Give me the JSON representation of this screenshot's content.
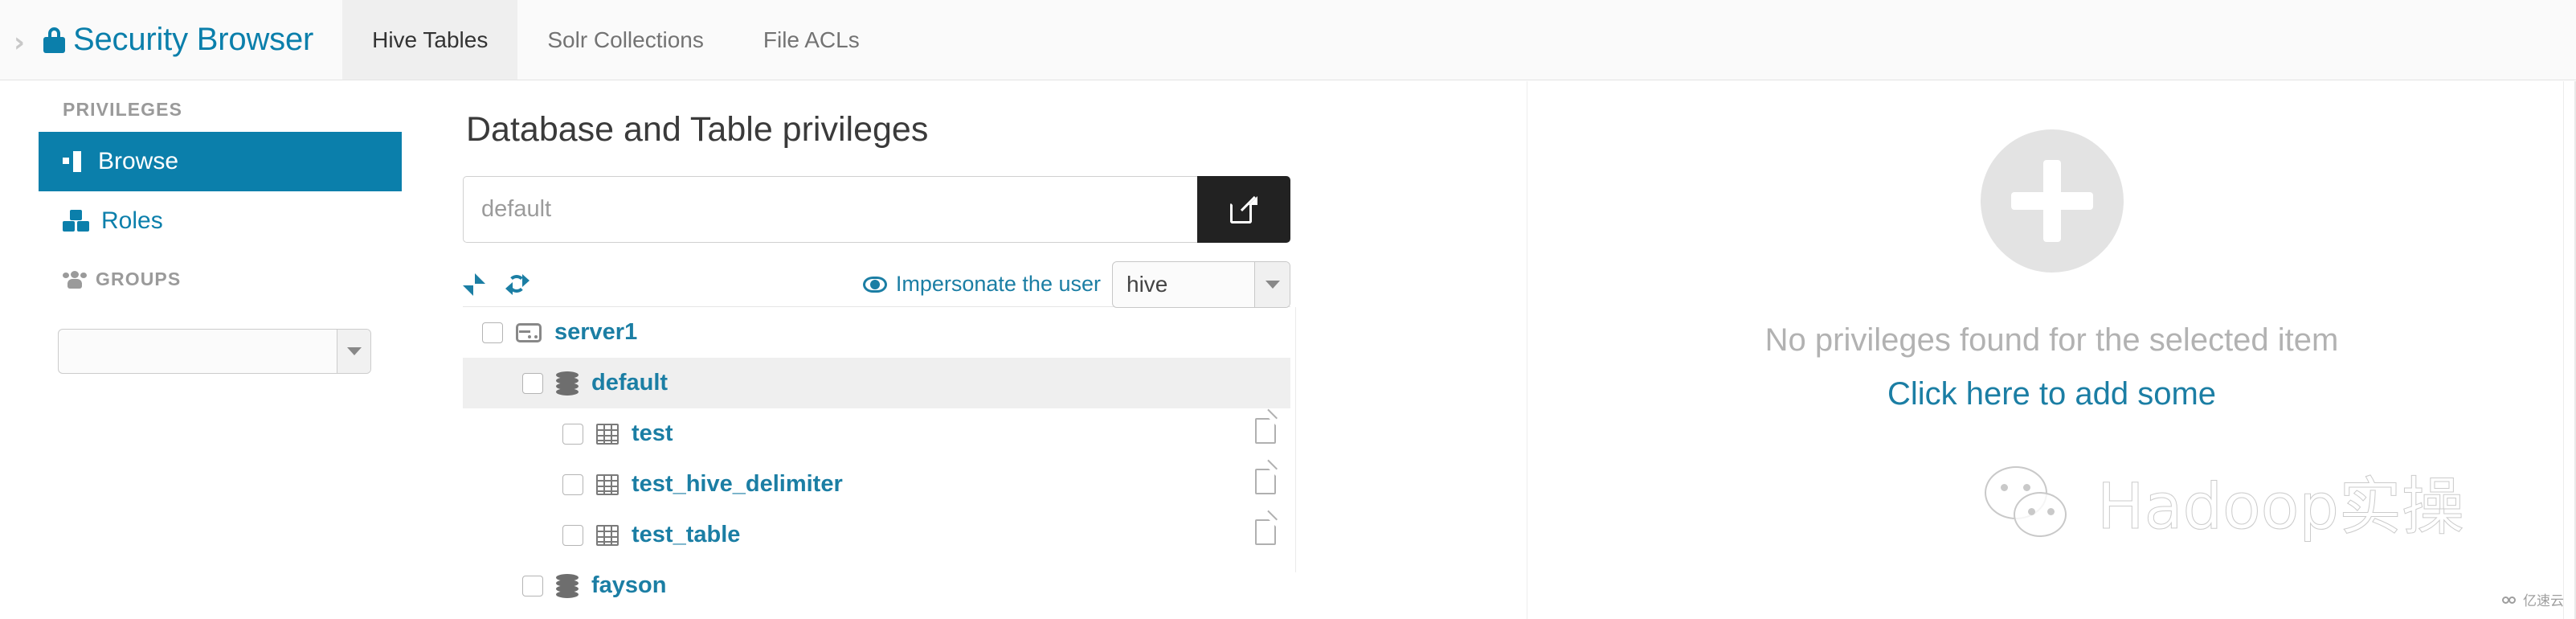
{
  "header": {
    "chevron_icon": "chevron-right-icon",
    "lock_icon": "lock-icon",
    "brand_title": "Security Browser",
    "tabs": [
      {
        "label": "Hive Tables",
        "active": true
      },
      {
        "label": "Solr Collections",
        "active": false
      },
      {
        "label": "File ACLs",
        "active": false
      }
    ]
  },
  "sidebar": {
    "privileges_label": "PRIVILEGES",
    "items": [
      {
        "label": "Browse",
        "icon": "sitemap-icon",
        "active": true
      },
      {
        "label": "Roles",
        "icon": "cubes-icon",
        "active": false
      }
    ],
    "groups_label": "GROUPS",
    "groups_icon": "users-icon",
    "groups_select_value": "",
    "groups_select_placeholder": ""
  },
  "main": {
    "page_title": "Database and Table privileges",
    "search": {
      "value": "default",
      "placeholder": "default",
      "button_icon": "external-link-icon"
    },
    "toolbar": {
      "collapse_icon": "collapse-arrows-icon",
      "refresh_icon": "refresh-icon",
      "impersonate_icon": "eye-icon",
      "impersonate_label": "Impersonate the user",
      "impersonate_user": "hive"
    },
    "tree": [
      {
        "label": "server1",
        "icon": "server-icon",
        "indent": 0,
        "selected": false,
        "file_icon": false
      },
      {
        "label": "default",
        "icon": "database-icon",
        "indent": 1,
        "selected": true,
        "file_icon": false
      },
      {
        "label": "test",
        "icon": "table-icon",
        "indent": 2,
        "selected": false,
        "file_icon": true
      },
      {
        "label": "test_hive_delimiter",
        "icon": "table-icon",
        "indent": 2,
        "selected": false,
        "file_icon": true
      },
      {
        "label": "test_table",
        "icon": "table-icon",
        "indent": 2,
        "selected": false,
        "file_icon": true
      },
      {
        "label": "fayson",
        "icon": "database-icon",
        "indent": 1,
        "selected": false,
        "file_icon": false
      }
    ]
  },
  "right_panel": {
    "plus_icon": "plus-circle-icon",
    "empty_text": "No privileges found for the selected item",
    "add_link": "Click here to add some"
  },
  "watermarks": {
    "brand_text": "Hadoop实操",
    "wechat_icon": "wechat-icon",
    "corner_text": "亿速云",
    "corner_icon": "cloud-icon"
  },
  "colors": {
    "accent": "#0b7fab",
    "link": "#1b7ea4",
    "active_bg": "#0b7fab",
    "dark_button": "#222222"
  }
}
